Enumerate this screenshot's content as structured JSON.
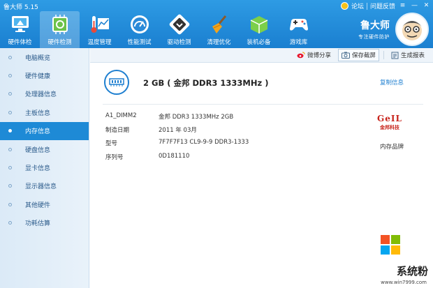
{
  "app": {
    "title": "鲁大师 5.15"
  },
  "window_controls": {
    "forum": "论坛",
    "feedback": "问题反馈"
  },
  "nav": {
    "items": [
      {
        "label": "硬件体检",
        "icon": "monitor-icon"
      },
      {
        "label": "硬件检测",
        "icon": "cpu-chip-icon"
      },
      {
        "label": "温度管理",
        "icon": "thermometer-icon"
      },
      {
        "label": "性能测试",
        "icon": "speedometer-icon"
      },
      {
        "label": "驱动检测",
        "icon": "driver-chip-icon"
      },
      {
        "label": "清理优化",
        "icon": "broom-icon"
      },
      {
        "label": "装机必备",
        "icon": "package-box-icon"
      },
      {
        "label": "游戏库",
        "icon": "gamepad-icon"
      }
    ],
    "active_index": 1
  },
  "brand": {
    "name": "鲁大师",
    "slogan": "专注硬件防护"
  },
  "sidebar": {
    "items": [
      {
        "label": "电脑概览"
      },
      {
        "label": "硬件健康"
      },
      {
        "label": "处理器信息"
      },
      {
        "label": "主板信息"
      },
      {
        "label": "内存信息"
      },
      {
        "label": "硬盘信息"
      },
      {
        "label": "显卡信息"
      },
      {
        "label": "显示器信息"
      },
      {
        "label": "其他硬件"
      },
      {
        "label": "功耗估算"
      }
    ],
    "active_index": 4
  },
  "toolbar": {
    "weibo_share": "微博分享",
    "save_screenshot": "保存截屏",
    "generate_report": "生成报表"
  },
  "memory": {
    "title": "2 GB ( 金邦 DDR3 1333MHz )",
    "copy_info": "复制信息",
    "specs": [
      {
        "label": "A1_DIMM2",
        "value": "金邦 DDR3 1333MHz 2GB"
      },
      {
        "label": "制造日期",
        "value": "2011 年 03月"
      },
      {
        "label": "型号",
        "value": "7F7F7F13 CL9-9-9 DDR3-1333"
      },
      {
        "label": "序列号",
        "value": "0D181110"
      }
    ],
    "brand_logo": {
      "line1": "GeIL",
      "line2": "金邦科技"
    },
    "brand_caption": "内存品牌"
  },
  "watermark": {
    "text": "系统粉",
    "url": "www.win7999.com"
  },
  "colors": {
    "topbar": "#1a7fd0",
    "accent": "#1e8ad6",
    "link": "#1e7fd0",
    "brand_red": "#c8241c"
  }
}
